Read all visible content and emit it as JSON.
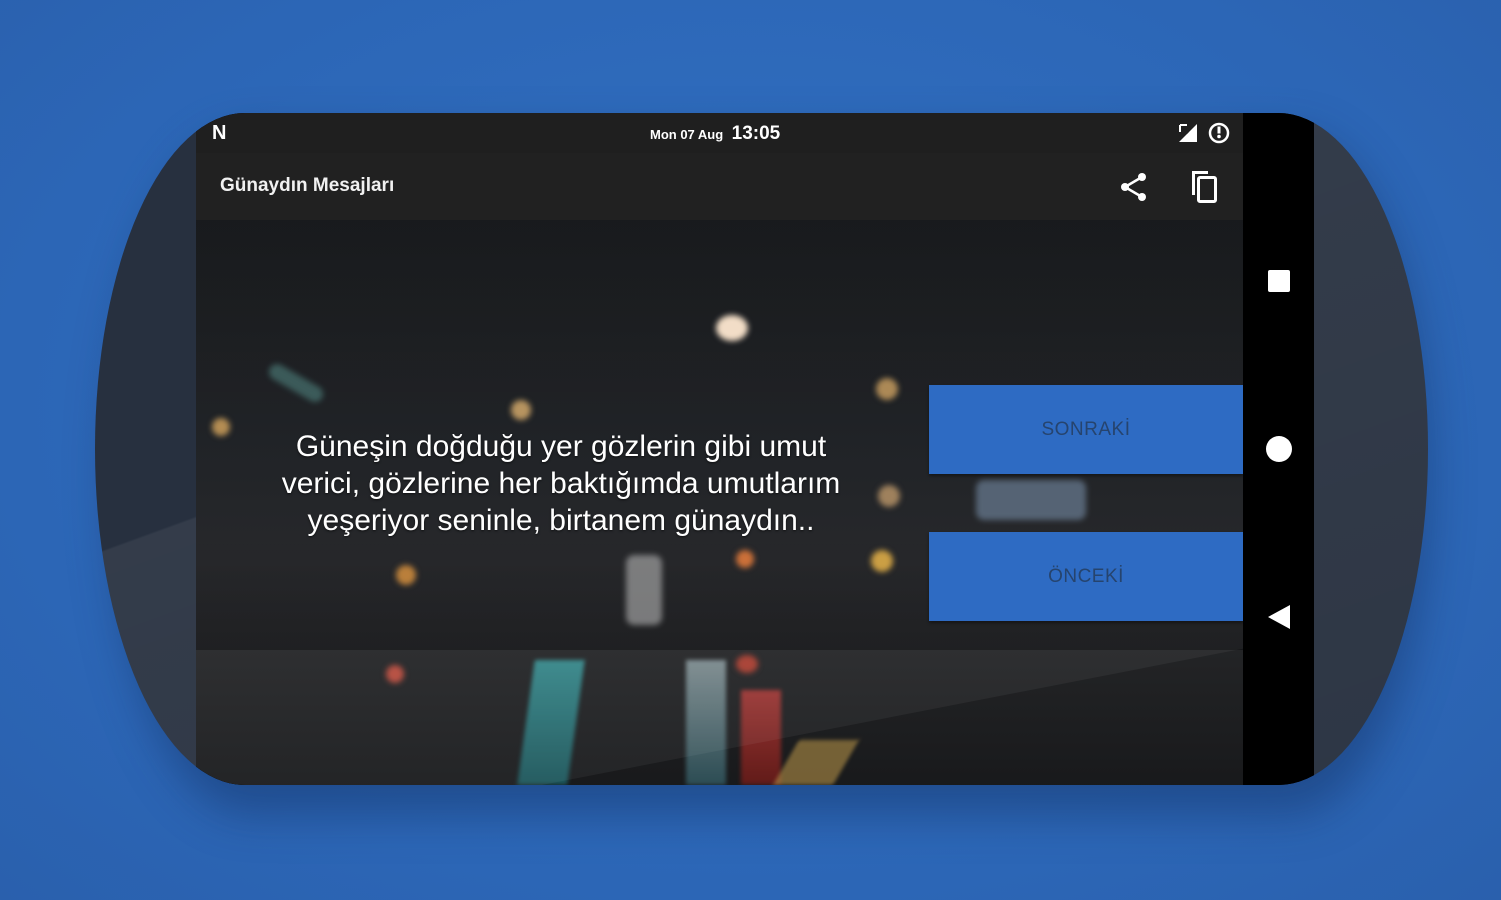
{
  "status_bar": {
    "app_badge": "N",
    "date": "Mon 07 Aug",
    "time": "13:05",
    "icons": [
      "no-signal-icon",
      "data-saver-icon"
    ]
  },
  "toolbar": {
    "title": "Günaydın Mesajları",
    "icons": [
      "share-icon",
      "copy-icon"
    ]
  },
  "message": {
    "text": "Güneşin doğduğu yer gözlerin gibi umut verici, gözlerine her baktığımda umutlarım yeşeriyor seninle, birtanem günaydın.."
  },
  "buttons": {
    "next_label": "SONRAKİ",
    "previous_label": "ÖNCEKİ"
  },
  "navigation_bar": {
    "icons": [
      "recents-icon",
      "home-icon",
      "back-icon"
    ]
  },
  "colors": {
    "background": "#2f6bbd",
    "device_body": "#27303f",
    "toolbar": "#212121",
    "button": "#2e6bc3",
    "button_text": "#26446e"
  }
}
